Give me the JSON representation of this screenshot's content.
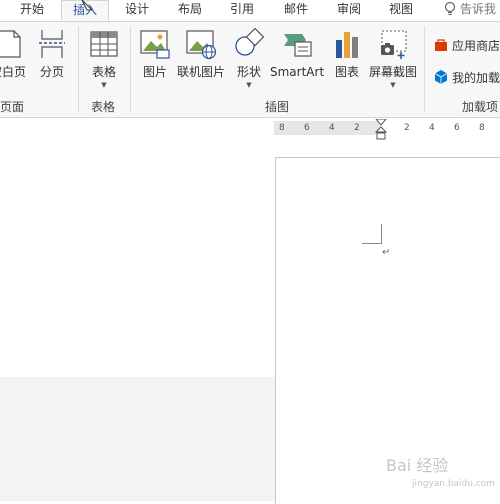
{
  "tabs": [
    "开始",
    "插入",
    "设计",
    "布局",
    "引用",
    "邮件",
    "审阅",
    "视图"
  ],
  "tell_me": "告诉我",
  "ribbon": {
    "pages_group": {
      "blank_page": "空白页",
      "page_break": "分页",
      "label": "页面"
    },
    "table_group": {
      "table": "表格",
      "label": "表格"
    },
    "illustrations_group": {
      "picture": "图片",
      "online_picture": "联机图片",
      "shapes": "形状",
      "smartart": "SmartArt",
      "chart": "图表",
      "screenshot": "屏幕截图",
      "label": "插图"
    },
    "addins_group": {
      "store": "应用商店",
      "my_addins": "我的加载",
      "label": "加载项"
    }
  },
  "ruler_numbers": [
    "8",
    "6",
    "4",
    "2",
    "2",
    "4",
    "6",
    "8"
  ],
  "paragraph_mark": "↵",
  "watermark": {
    "main": "Bai 经验",
    "sub": "jingyan.baidu.com"
  },
  "colors": {
    "accent": "#2b579a",
    "ribbon_bg": "#f7f7f7",
    "store_icon": "#d83b01",
    "addin_icon": "#0078d4"
  }
}
